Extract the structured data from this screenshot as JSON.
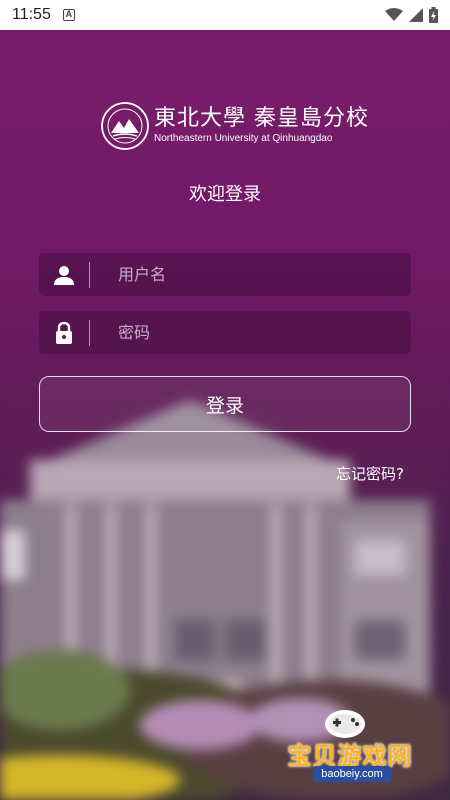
{
  "status_bar": {
    "time": "11:55",
    "icons": [
      "android-auto-icon",
      "wifi-icon",
      "signal-icon",
      "battery-icon"
    ]
  },
  "logo": {
    "name_cn": "東北大學 秦皇島分校",
    "name_en": "Northeastern University at Qinhuangdao"
  },
  "welcome_text": "欢迎登录",
  "login_form": {
    "username_placeholder": "用户名",
    "password_placeholder": "密码",
    "login_label": "登录",
    "forgot_password": "忘记密码?"
  },
  "watermark": {
    "title": "宝贝游戏网",
    "url": "baobeiy.com"
  },
  "colors": {
    "primary_purple": "#7a1d6c",
    "field_bg": "#460e40",
    "text": "#ffffff",
    "watermark_orange": "#ffb21a"
  }
}
